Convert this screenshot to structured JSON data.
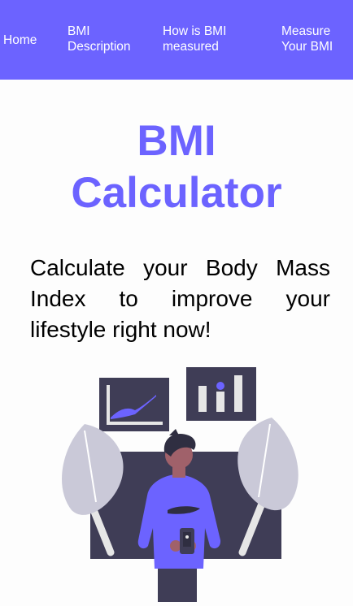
{
  "nav": {
    "home": "Home",
    "description_line1": "BMI",
    "description_line2": "Description",
    "measured_line1": "How is BMI",
    "measured_line2": "measured",
    "measure_line1": "Measure",
    "measure_line2": "Your BMI"
  },
  "hero": {
    "title_line1": "BMI",
    "title_line2": "Calculator",
    "subtitle": "Calculate your Body Mass Index to improve your lifestyle right now!"
  },
  "colors": {
    "accent": "#6c63ff",
    "dark": "#3f3d56",
    "leaf": "#cac9d8",
    "skin": "#a0616a"
  },
  "illustration": {
    "name": "person-with-charts-illustration"
  }
}
